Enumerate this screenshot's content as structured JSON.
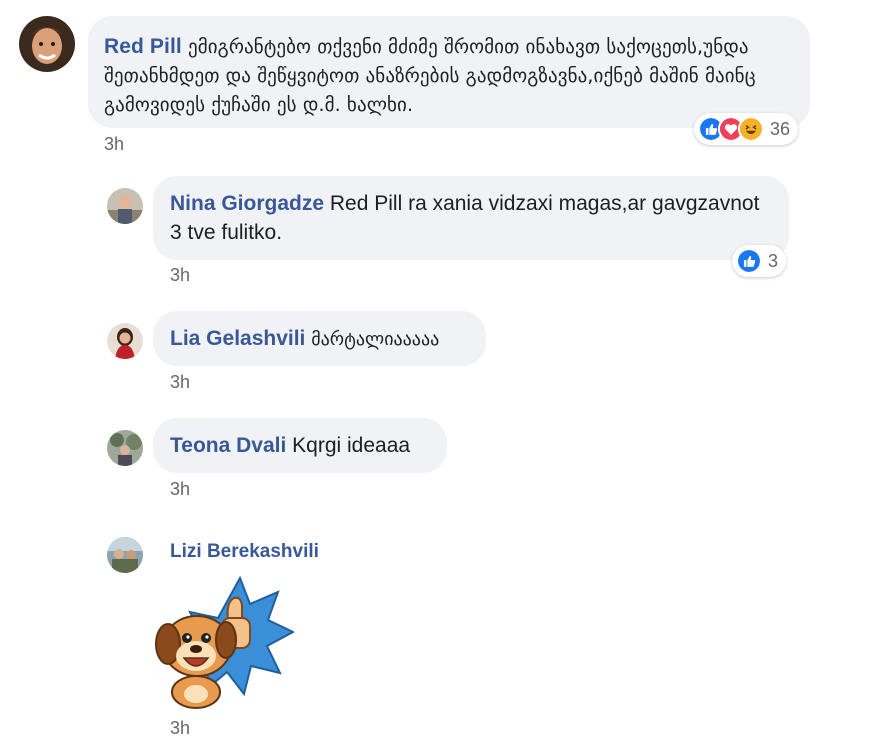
{
  "comments": [
    {
      "author": "Red Pill",
      "text": "ემიგრანტებო თქვენი მძიმე შრომით ინახავთ საქოცეთს,უნდა შეთანხმდეთ და შეწყვიტოთ ანაზრების გადმოგზავნა,იქნებ მაშინ მაინც გამოვიდეს ქუჩაში ეს დ.მ. ხალხი.",
      "time": "3h",
      "reactions": {
        "icons": [
          "like-icon",
          "love-icon",
          "haha-icon"
        ],
        "count": "36"
      },
      "colors": {
        "like": "#1877f2",
        "love": "#f33e58",
        "haha": "#f7b125"
      }
    }
  ],
  "replies": [
    {
      "author": "Nina Giorgadze",
      "text": "Red Pill ra xania vidzaxi magas,ar gavgzavnot 3 tve fulitko.",
      "time": "3h",
      "reactions": {
        "icons": [
          "like-icon"
        ],
        "count": "3"
      }
    },
    {
      "author": "Lia Gelashvili",
      "text": "მარტალიააააა",
      "time": "3h"
    },
    {
      "author": "Teona Dvali",
      "text": "Kqrgi ideaaa",
      "time": "3h"
    },
    {
      "author": "Lizi Berekashvili",
      "sticker": "dog-thumbs-up-sticker",
      "time": "3h"
    }
  ],
  "colors": {
    "author": "#385898",
    "bubble": "#f0f2f5",
    "timestamp": "#65676b"
  }
}
